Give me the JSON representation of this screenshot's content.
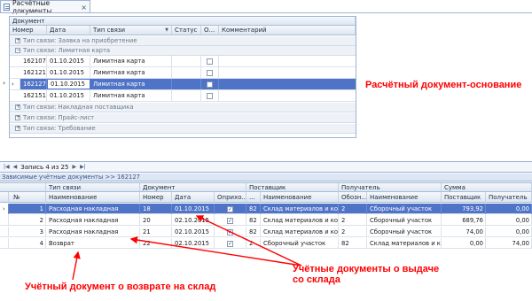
{
  "tab": {
    "title": "Расчётные документы",
    "close": "×"
  },
  "top_grid": {
    "group_header": "Документ",
    "columns": [
      "Номер",
      "Дата",
      "Тип связи",
      "Статус",
      "О...",
      "Комментарий"
    ],
    "groups": [
      {
        "label": "Тип связи: Заявка на приобретение",
        "expander": "+"
      },
      {
        "label": "Тип связи: Лимитная карта",
        "expander": "−"
      },
      {
        "label": "Тип связи: Накладная поставщика",
        "expander": "+"
      },
      {
        "label": "Тип связи: Прайс-лист",
        "expander": "+"
      },
      {
        "label": "Тип связи: Требование",
        "expander": "+"
      }
    ],
    "rows": [
      {
        "number": "162107",
        "date": "01.10.2015",
        "type": "Лимитная карта"
      },
      {
        "number": "162121",
        "date": "01.10.2015",
        "type": "Лимитная карта"
      },
      {
        "number": "162127",
        "date": "01.10.2015",
        "type": "Лимитная карта",
        "selected": true
      },
      {
        "number": "162151",
        "date": "01.10.2015",
        "type": "Лимитная карта"
      }
    ]
  },
  "annotations": {
    "base_doc": "Расчётный документ-основание",
    "issue_docs": "Учётные документы о выдаче со склада",
    "return_doc": "Учётный документ о возврате на склад"
  },
  "navigator": {
    "record_text": "Запись 4 из 25"
  },
  "bottom_panel": {
    "title": "Зависимые учётные документы >> 162127"
  },
  "bottom_grid": {
    "bands": [
      "Тип связи",
      "Документ",
      "Поставщик",
      "Получатель",
      "Сумма"
    ],
    "columns": [
      "№",
      "Наименование",
      "Номер",
      "Дата",
      "Оприхо...",
      "...",
      "Наименование",
      "Обозн...",
      "Наименование",
      "Поставщик",
      "Получатель"
    ],
    "rows": [
      {
        "n": "1",
        "name": "Расходная накладная",
        "number": "18",
        "date": "01.10.2015",
        "posted": true,
        "code": "82",
        "supplier": "Склад материалов и ком...",
        "rcode": "2",
        "receiver": "Сборочный участок",
        "sum_s": "793,92",
        "sum_r": "0,00",
        "selected": true
      },
      {
        "n": "2",
        "name": "Расходная накладная",
        "number": "20",
        "date": "02.10.2015",
        "posted": true,
        "code": "82",
        "supplier": "Склад материалов и ком...",
        "rcode": "2",
        "receiver": "Сборочный участок",
        "sum_s": "689,76",
        "sum_r": "0,00"
      },
      {
        "n": "3",
        "name": "Расходная накладная",
        "number": "21",
        "date": "02.10.2015",
        "posted": true,
        "code": "82",
        "supplier": "Склад материалов и ком...",
        "rcode": "2",
        "receiver": "Сборочный участок",
        "sum_s": "74,00",
        "sum_r": "0,00"
      },
      {
        "n": "4",
        "name": "Возврат",
        "number": "22",
        "date": "02.10.2015",
        "posted": true,
        "code": "2",
        "supplier": "Сборочный участок",
        "rcode": "82",
        "receiver": "Склад материалов и ком...",
        "sum_s": "0,00",
        "sum_r": "74,00"
      }
    ]
  },
  "colors": {
    "selection": "#4f74c7",
    "annotation": "#ff0000",
    "border": "#9eb4d3"
  }
}
